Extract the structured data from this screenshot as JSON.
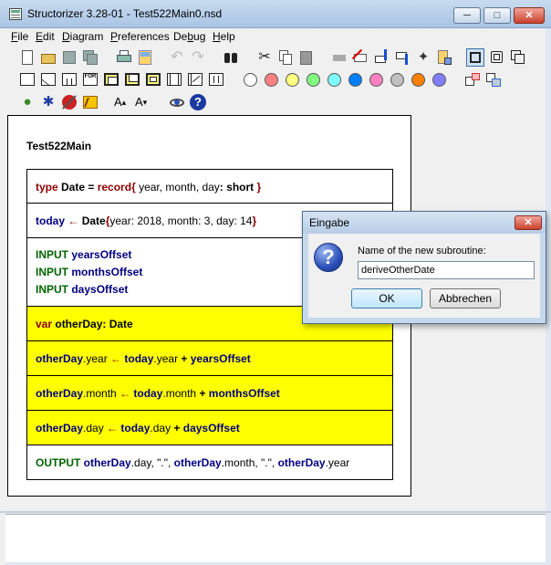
{
  "window": {
    "title": "Structorizer 3.28-01 - Test522Main0.nsd",
    "minimize": "─",
    "maximize": "□",
    "close": "✕"
  },
  "menu": {
    "items": [
      {
        "first": "F",
        "rest": "ile"
      },
      {
        "first": "E",
        "rest": "dit"
      },
      {
        "first": "D",
        "rest": "iagram"
      },
      {
        "first": "P",
        "rest": "references"
      },
      {
        "first": "D",
        "rest": "ebug",
        "prefix": "De",
        "mid": "b",
        "suffix": "ug"
      },
      {
        "first": "H",
        "rest": "elp"
      }
    ]
  },
  "toolbar": {
    "colors": [
      "#ffffff",
      "#ff8080",
      "#ffff80",
      "#80ff80",
      "#80ffff",
      "#0080ff",
      "#ff80c0",
      "#c0c0c0",
      "#ff8000",
      "#8080ff"
    ],
    "for_label": "FOR",
    "font_up": "A",
    "font_down": "A"
  },
  "diagram": {
    "title": "Test522Main",
    "elements": [
      {
        "id": "type-def",
        "parts": [
          {
            "t": "type ",
            "c": "kw"
          },
          {
            "t": "Date ",
            "c": "b"
          },
          {
            "t": "= ",
            "c": "b"
          },
          {
            "t": "record",
            "c": "kw"
          },
          {
            "t": "{ ",
            "c": "kw"
          },
          {
            "t": "year, month, day",
            "c": ""
          },
          {
            "t": ": ",
            "c": "b"
          },
          {
            "t": "short ",
            "c": "b"
          },
          {
            "t": "}",
            "c": "kw"
          }
        ]
      },
      {
        "id": "today-assign",
        "parts": [
          {
            "t": "today ",
            "c": "var"
          },
          {
            "t": "← ",
            "c": "arr"
          },
          {
            "t": "Date",
            "c": "b"
          },
          {
            "t": "{",
            "c": "kw"
          },
          {
            "t": "year: 2018, month: 3, day: 14",
            "c": ""
          },
          {
            "t": "}",
            "c": "kw"
          }
        ]
      },
      {
        "id": "input-1",
        "parts": [
          {
            "t": "INPUT ",
            "c": "kwg"
          },
          {
            "t": "yearsOffset",
            "c": "var"
          }
        ]
      },
      {
        "id": "input-2",
        "parts": [
          {
            "t": "INPUT ",
            "c": "kwg"
          },
          {
            "t": "monthsOffset",
            "c": "var"
          }
        ]
      },
      {
        "id": "input-3",
        "parts": [
          {
            "t": "INPUT ",
            "c": "kwg"
          },
          {
            "t": "daysOffset",
            "c": "var"
          }
        ]
      },
      {
        "id": "var-decl",
        "parts": [
          {
            "t": "var ",
            "c": "kw"
          },
          {
            "t": "otherDay",
            "c": "b"
          },
          {
            "t": ": ",
            "c": "b"
          },
          {
            "t": "Date",
            "c": "b"
          }
        ]
      },
      {
        "id": "assign-year",
        "parts": [
          {
            "t": "otherDay",
            "c": "var"
          },
          {
            "t": ".year ",
            "c": ""
          },
          {
            "t": "← ",
            "c": "arr"
          },
          {
            "t": "today",
            "c": "var"
          },
          {
            "t": ".year ",
            "c": ""
          },
          {
            "t": "+ ",
            "c": "b"
          },
          {
            "t": "yearsOffset",
            "c": "var"
          }
        ]
      },
      {
        "id": "assign-month",
        "parts": [
          {
            "t": "otherDay",
            "c": "var"
          },
          {
            "t": ".month ",
            "c": ""
          },
          {
            "t": "← ",
            "c": "arr"
          },
          {
            "t": "today",
            "c": "var"
          },
          {
            "t": ".month ",
            "c": ""
          },
          {
            "t": "+ ",
            "c": "b"
          },
          {
            "t": "monthsOffset",
            "c": "var"
          }
        ]
      },
      {
        "id": "assign-day",
        "parts": [
          {
            "t": "otherDay",
            "c": "var"
          },
          {
            "t": ".day ",
            "c": ""
          },
          {
            "t": "← ",
            "c": "arr"
          },
          {
            "t": "today",
            "c": "var"
          },
          {
            "t": ".day ",
            "c": ""
          },
          {
            "t": "+ ",
            "c": "b"
          },
          {
            "t": "daysOffset",
            "c": "var"
          }
        ]
      },
      {
        "id": "output",
        "parts": [
          {
            "t": "OUTPUT ",
            "c": "kwg"
          },
          {
            "t": "otherDay",
            "c": "var"
          },
          {
            "t": ".day, \".\", ",
            "c": ""
          },
          {
            "t": "otherDay",
            "c": "var"
          },
          {
            "t": ".month, \".\", ",
            "c": ""
          },
          {
            "t": "otherDay",
            "c": "var"
          },
          {
            "t": ".year",
            "c": ""
          }
        ]
      }
    ]
  },
  "dialog": {
    "title": "Eingabe",
    "close": "✕",
    "icon": "?",
    "label": "Name of the new subroutine:",
    "input_value": "deriveOtherDate",
    "ok_label": "OK",
    "cancel_label": "Abbrechen"
  }
}
